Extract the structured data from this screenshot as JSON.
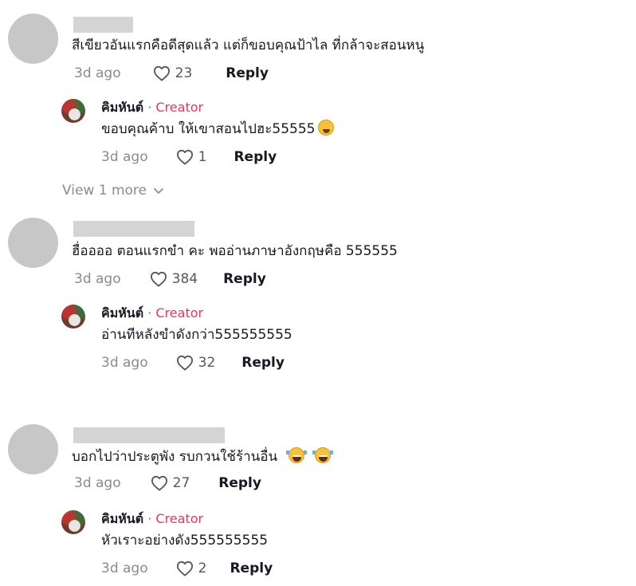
{
  "icons": {
    "like": "heart-outline-icon",
    "expand": "chevron-down-icon",
    "emoji_sweat": "sweat-smile-emoji",
    "emoji_laugh": "tears-of-joy-emoji"
  },
  "colors": {
    "creator": "#e03b5b",
    "muted": "#8a8b91",
    "text": "#161823"
  },
  "comments": [
    {
      "text": "สีเขียวอันแรกคือดีสุดแล้ว แต่ก็ขอบคุณป้าไล ที่กล้าจะสอนหนู",
      "date": "3d ago",
      "likes": "23",
      "reply_label": "Reply",
      "reply": {
        "name": "คิมหันต์",
        "dot": " · ",
        "badge": "Creator",
        "text": "ขอบคุณค้าบ ให้เขาสอนไปฮะ55555",
        "date": "3d ago",
        "likes": "1",
        "reply_label": "Reply"
      },
      "view_more": "View 1 more"
    },
    {
      "text": "ฮื่ออออ ตอนแรกขำ คะ พออ่านภาษาอังกฤษคือ 555555",
      "date": "3d ago",
      "likes": "384",
      "reply_label": "Reply",
      "reply": {
        "name": "คิมหันต์",
        "dot": " · ",
        "badge": "Creator",
        "text": "อ่านทีหลังขำดังกว่า555555555",
        "date": "3d ago",
        "likes": "32",
        "reply_label": "Reply"
      }
    },
    {
      "text": "บอกไปว่าประตูพัง รบกวนใช้ร้านอื่น",
      "date": "3d ago",
      "likes": "27",
      "reply_label": "Reply",
      "reply": {
        "name": "คิมหันต์",
        "dot": " · ",
        "badge": "Creator",
        "text": "หัวเราะอย่างดัง555555555",
        "date": "3d ago",
        "likes": "2",
        "reply_label": "Reply"
      }
    }
  ]
}
